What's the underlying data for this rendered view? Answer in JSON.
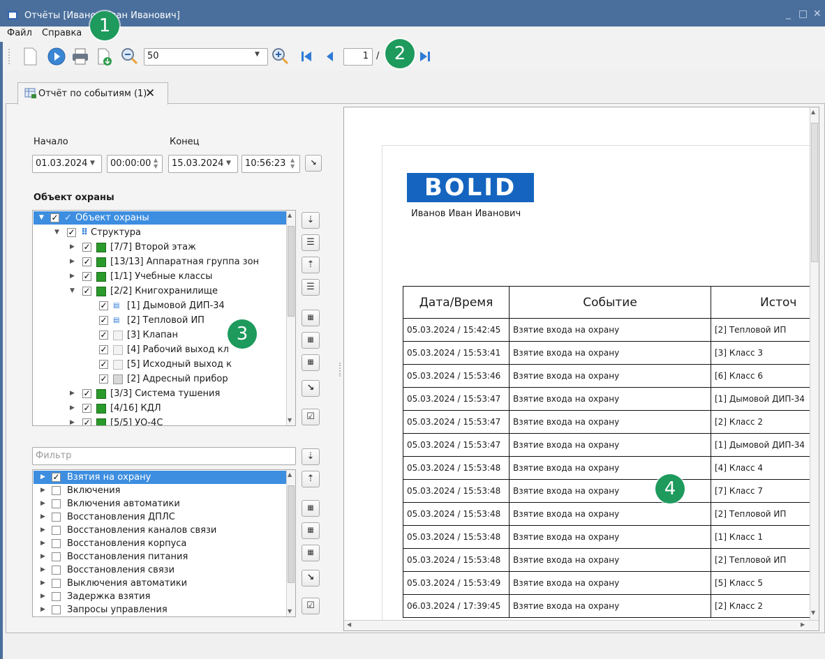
{
  "window": {
    "title": "Отчёты [Иванов Иван Иванович]",
    "minimize": "_",
    "maximize": "□",
    "close": "✕"
  },
  "menu": {
    "file": "Файл",
    "help": "Справка"
  },
  "toolbar": {
    "zoom_value": "50",
    "page_value": "1",
    "page_separator": "/"
  },
  "callouts": [
    "1",
    "2",
    "3",
    "4"
  ],
  "tab": {
    "label": "Отчёт по событиям (1)"
  },
  "period": {
    "start_label": "Начало",
    "end_label": "Конец",
    "start_date": "01.03.2024",
    "start_time": "00:00:00",
    "end_date": "15.03.2024",
    "end_time": "10:56:23"
  },
  "objects": {
    "heading": "Объект охраны",
    "rows": [
      {
        "label": "Объект охраны"
      },
      {
        "label": "Структура"
      },
      {
        "label": "[7/7] Второй этаж"
      },
      {
        "label": "[13/13] Аппаратная группа зон"
      },
      {
        "label": "[1/1] Учебные классы"
      },
      {
        "label": "[2/2] Книгохранилище"
      },
      {
        "label": "[1] Дымовой ДИП-34"
      },
      {
        "label": "[2] Тепловой ИП"
      },
      {
        "label": "[3] Клапан"
      },
      {
        "label": "[4] Рабочий выход кл"
      },
      {
        "label": "[5] Исходный выход к"
      },
      {
        "label": "[2] Адресный прибор"
      },
      {
        "label": "[3/3] Система тушения"
      },
      {
        "label": "[4/16] КДЛ"
      },
      {
        "label": "[5/5] УО-4С"
      }
    ]
  },
  "filter": {
    "placeholder": "Фильтр",
    "rows": [
      {
        "label": "Взятия на охрану"
      },
      {
        "label": "Включения"
      },
      {
        "label": "Включения автоматики"
      },
      {
        "label": "Восстановления ДПЛС"
      },
      {
        "label": "Восстановления каналов связи"
      },
      {
        "label": "Восстановления корпуса"
      },
      {
        "label": "Восстановления питания"
      },
      {
        "label": "Восстановления связи"
      },
      {
        "label": "Выключения автоматики"
      },
      {
        "label": "Задержка взятия"
      },
      {
        "label": "Запросы управления"
      }
    ]
  },
  "report": {
    "logo_text": "BOLID",
    "author": "Иванов Иван Иванович",
    "columns": [
      "Дата/Время",
      "Событие",
      "Источ"
    ],
    "rows": [
      [
        "05.03.2024 / 15:42:45",
        "Взятие входа на охрану",
        "[2] Тепловой ИП"
      ],
      [
        "05.03.2024 / 15:53:41",
        "Взятие входа на охрану",
        "[3] Класс 3"
      ],
      [
        "05.03.2024 / 15:53:46",
        "Взятие входа на охрану",
        "[6] Класс 6"
      ],
      [
        "05.03.2024 / 15:53:47",
        "Взятие входа на охрану",
        "[1] Дымовой ДИП-34"
      ],
      [
        "05.03.2024 / 15:53:47",
        "Взятие входа на охрану",
        "[2] Класс 2"
      ],
      [
        "05.03.2024 / 15:53:47",
        "Взятие входа на охрану",
        "[1] Дымовой ДИП-34"
      ],
      [
        "05.03.2024 / 15:53:48",
        "Взятие входа на охрану",
        "[4] Класс 4"
      ],
      [
        "05.03.2024 / 15:53:48",
        "Взятие входа на охрану",
        "[7] Класс 7"
      ],
      [
        "05.03.2024 / 15:53:48",
        "Взятие входа на охрану",
        "[2] Тепловой ИП"
      ],
      [
        "05.03.2024 / 15:53:48",
        "Взятие входа на охрану",
        "[1] Класс 1"
      ],
      [
        "05.03.2024 / 15:53:48",
        "Взятие входа на охрану",
        "[2] Тепловой ИП"
      ],
      [
        "05.03.2024 / 15:53:49",
        "Взятие входа на охрану",
        "[5] Класс 5"
      ],
      [
        "06.03.2024 / 17:39:45",
        "Взятие входа на охрану",
        "[2] Класс 2"
      ]
    ]
  },
  "colors": {
    "titlebar": "#4a6f9c",
    "selection": "#3d8ee0",
    "callout": "#1d9a5c",
    "logo": "#1565c0"
  }
}
